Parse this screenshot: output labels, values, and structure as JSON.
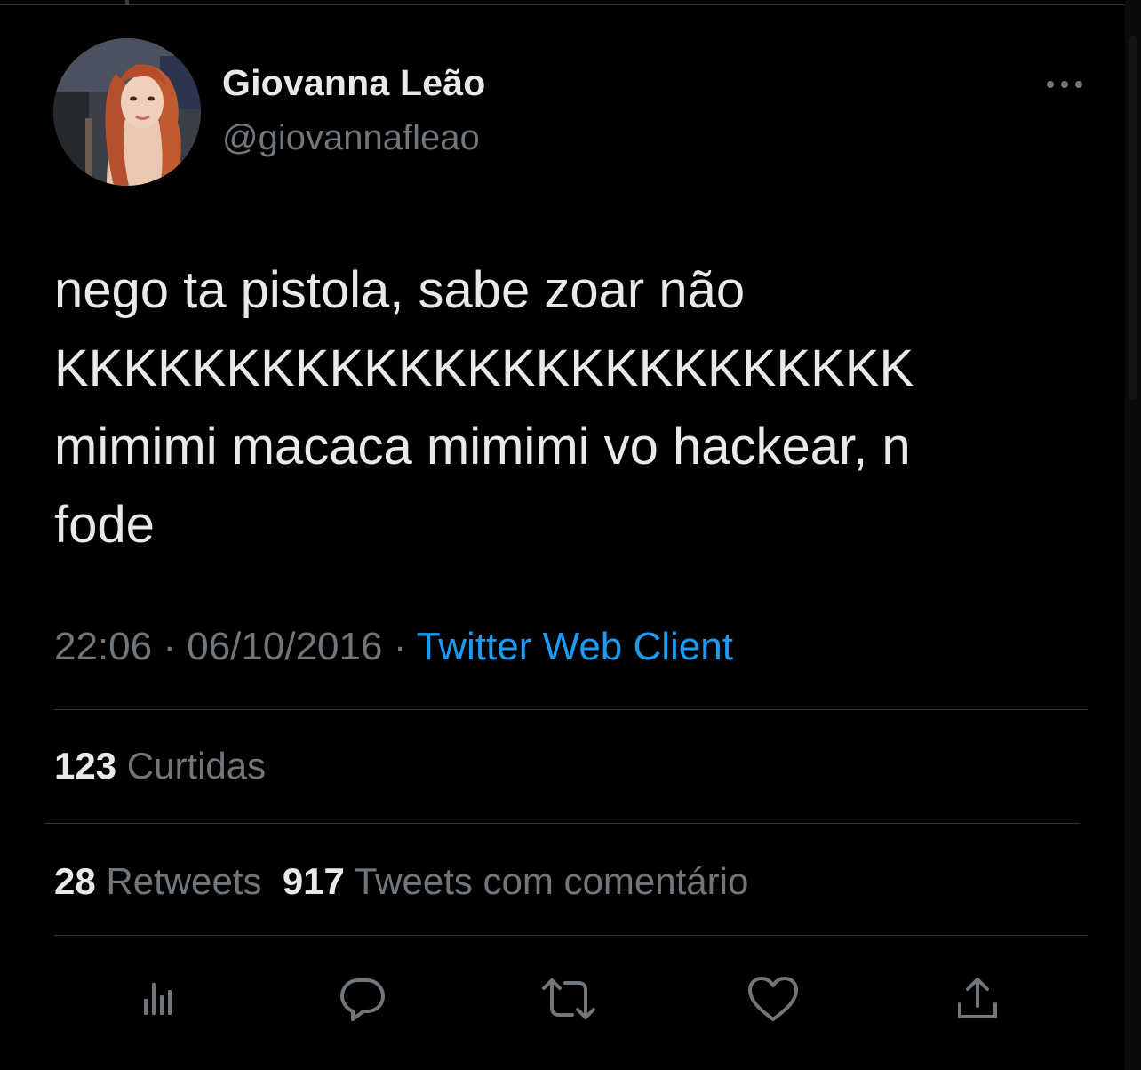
{
  "user": {
    "display_name": "Giovanna Leão",
    "handle": "@giovannafleao"
  },
  "tweet": {
    "lines": [
      "nego ta pistola, sabe zoar não",
      "KKKKKKKKKKKKKKKKKKKKKKKKK",
      "mimimi macaca mimimi vo hackear, n",
      "fode"
    ],
    "time": "22:06",
    "separator": "·",
    "date": "06/10/2016",
    "source": "Twitter Web Client"
  },
  "stats": {
    "likes_count": "123",
    "likes_label": "Curtidas",
    "retweets_count": "28",
    "retweets_label": "Retweets",
    "quotes_count": "917",
    "quotes_label": "Tweets com comentário"
  },
  "actions": {
    "icons": [
      "analytics-icon",
      "reply-icon",
      "retweet-icon",
      "like-icon",
      "share-icon"
    ]
  },
  "colors": {
    "background": "#000000",
    "text_primary": "#e7e9ea",
    "text_secondary": "#71767b",
    "accent": "#1d9bf0",
    "divider": "#2f3336"
  }
}
